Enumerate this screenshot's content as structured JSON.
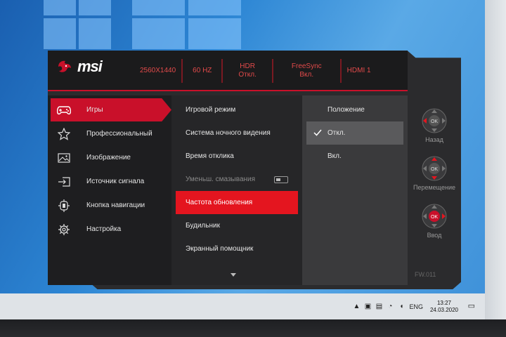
{
  "header": {
    "brand": "msi",
    "cells": [
      {
        "line1": "2560X1440",
        "line2": ""
      },
      {
        "line1": "60 HZ",
        "line2": ""
      },
      {
        "line1": "HDR",
        "line2": "Откл."
      },
      {
        "line1": "FreeSync",
        "line2": "Вкл."
      },
      {
        "line1": "HDMI 1",
        "line2": ""
      }
    ]
  },
  "menu": {
    "items": [
      {
        "label": "Игры",
        "icon": "gamepad-icon",
        "active": true
      },
      {
        "label": "Профессиональный",
        "icon": "star-icon"
      },
      {
        "label": "Изображение",
        "icon": "image-icon"
      },
      {
        "label": "Источник сигнала",
        "icon": "input-source-icon"
      },
      {
        "label": "Кнопка навигации",
        "icon": "navigation-key-icon"
      },
      {
        "label": "Настройка",
        "icon": "gear-icon"
      }
    ]
  },
  "submenu": {
    "items": [
      {
        "label": "Игровой режим"
      },
      {
        "label": "Система ночного видения"
      },
      {
        "label": "Время отклика"
      },
      {
        "label": "Уменьш. смазывания",
        "disabled": true
      },
      {
        "label": "Частота обновления",
        "selected": true
      },
      {
        "label": "Будильник"
      },
      {
        "label": "Экранный помощник"
      }
    ]
  },
  "options": {
    "title": "Положение",
    "items": [
      {
        "label": "Откл.",
        "checked": true
      },
      {
        "label": "Вкл."
      }
    ]
  },
  "nav": {
    "ok_label": "OK",
    "items": [
      {
        "label": "Назад"
      },
      {
        "label": "Перемещение"
      },
      {
        "label": "Ввод"
      }
    ]
  },
  "firmware": "FW.011",
  "taskbar": {
    "language": "ENG",
    "time": "13:27",
    "date": "24.03.2020"
  },
  "colors": {
    "accent": "#c9102a",
    "selected": "#e4151f",
    "header_text": "#e24a4a"
  }
}
